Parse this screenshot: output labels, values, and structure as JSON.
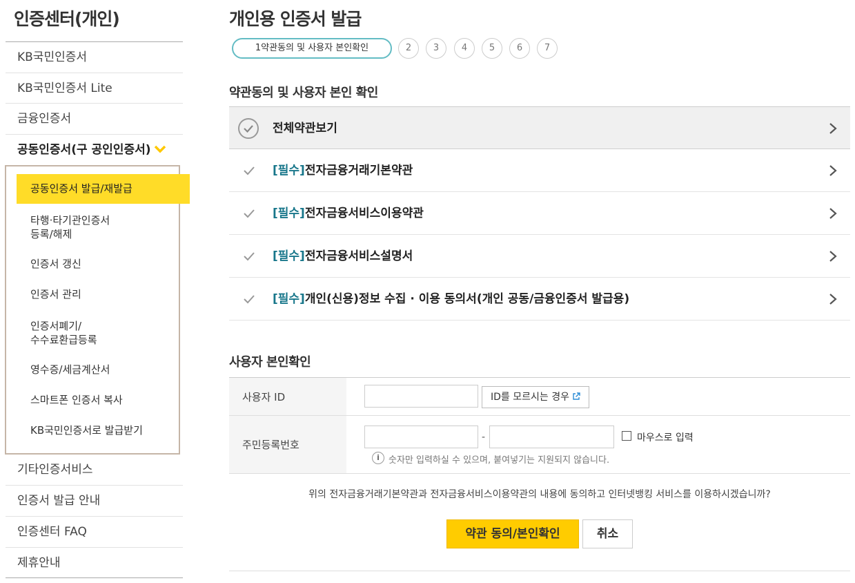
{
  "sidebar": {
    "title": "인증센터(개인)",
    "items": [
      {
        "label": "KB국민인증서"
      },
      {
        "label": "KB국민인증서 Lite"
      },
      {
        "label": "금융인증서"
      },
      {
        "label": "공동인증서(구 공인인증서)"
      }
    ],
    "sub_items": [
      {
        "label": "공동인증서 발급/재발급"
      },
      {
        "label_line1": "타행·타기관인증서",
        "label_line2": "등록/해제"
      },
      {
        "label": "인증서 갱신"
      },
      {
        "label": "인증서 관리"
      },
      {
        "label_line1": "인증서폐기/",
        "label_line2": "수수료환급등록"
      },
      {
        "label": "영수증/세금계산서"
      },
      {
        "label": "스마트폰 인증서 복사"
      },
      {
        "label": "KB국민인증서로 발급받기"
      }
    ],
    "bottom_items": [
      {
        "label": "기타인증서비스"
      },
      {
        "label": "인증서 발급 안내"
      },
      {
        "label": "인증센터 FAQ"
      },
      {
        "label": "제휴안내"
      }
    ]
  },
  "main": {
    "title": "개인용 인증서 발급",
    "steps": {
      "active": "1약관동의 및 사용자 본인확인",
      "others": [
        "2",
        "3",
        "4",
        "5",
        "6",
        "7"
      ]
    },
    "terms_section_title": "약관동의 및 사용자 본인 확인",
    "terms": {
      "all_label": "전체약관보기",
      "required_tag": "[필수]",
      "items": [
        {
          "label": "전자금융거래기본약관"
        },
        {
          "label": "전자금융서비스이용약관"
        },
        {
          "label": "전자금융서비스설명서"
        },
        {
          "label": "개인(신용)정보 수집 · 이용 동의서(개인 공동/금융인증서 발급용)"
        }
      ]
    },
    "user_section_title": "사용자 본인확인",
    "form": {
      "user_id_label": "사용자 ID",
      "user_id_value": "",
      "forgot_id_button": "ID를 모르시는 경우",
      "rrn_label": "주민등록번호",
      "rrn_first_value": "",
      "rrn_second_value": "",
      "rrn_separator": "-",
      "mouse_input_label": "마우스로 입력",
      "note_icon": "i",
      "note": "숫자만 입력하실 수 있으며, 붙여넣기는 지원되지 않습니다."
    },
    "confirm_question": "위의 전자금융거래기본약관과 전자금융서비스이용약관의 내용에 동의하고 인터넷뱅킹 서비스를 이용하시겠습니까?",
    "agree_button": "약관 동의/본인확인",
    "cancel_button": "취소"
  },
  "colors": {
    "accent_yellow": "#ffcc00",
    "active_menu_yellow": "#ffdc28",
    "required_tag": "#17768a",
    "step_border": "#63bcc4"
  }
}
